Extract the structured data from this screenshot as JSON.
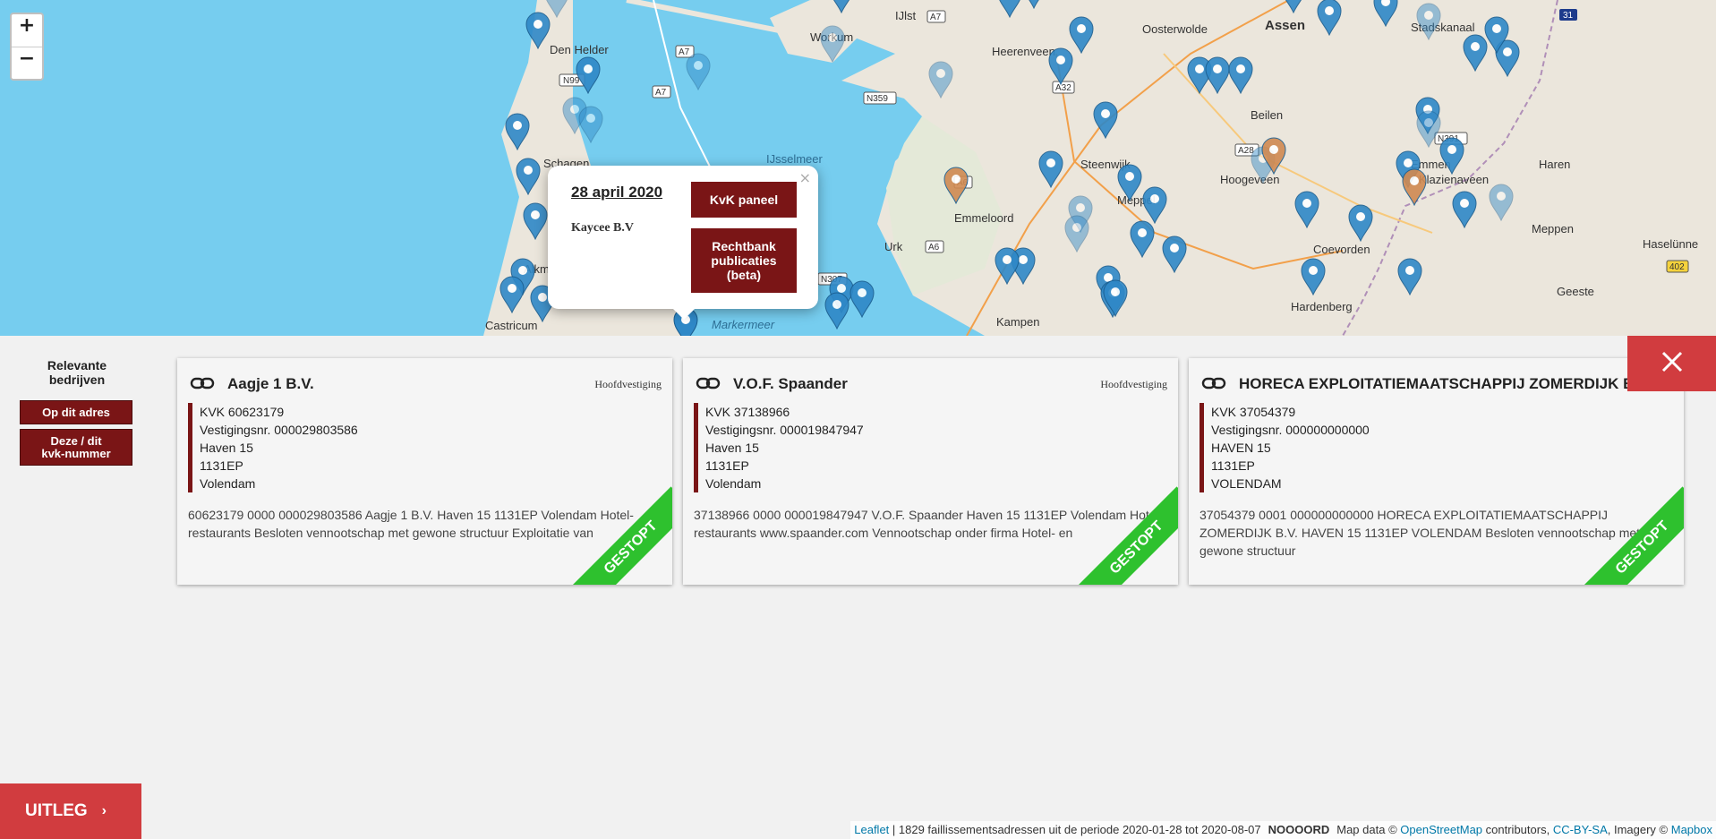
{
  "map": {
    "zoom_in": "+",
    "zoom_out": "−",
    "place_labels": [
      "Den Helder",
      "Schagen",
      "Alkmaar",
      "Castricum",
      "Workum",
      "IJlst",
      "Heerenveen",
      "Oosterwolde",
      "Assen",
      "Stadskanaal",
      "Beilen",
      "Steenwijk",
      "Emmeloord",
      "Urk",
      "Hoogeveen",
      "Meppel",
      "Emmen",
      "Klazienaveen",
      "Haren",
      "Coevorden",
      "Meppen",
      "Haselünne",
      "Kampen",
      "Hardenberg",
      "Geeste",
      "IJsselmeer",
      "Markermeer"
    ],
    "road_labels": [
      "A7",
      "A7",
      "N99",
      "A7",
      "A32",
      "N359",
      "N391",
      "A28",
      "A6",
      "A6",
      "N307",
      "31",
      "402"
    ],
    "colors": {
      "water": "#76cdef",
      "land": "#ebe6dc",
      "pin_blue": "#2f88c7",
      "pin_orange": "#d08a52"
    }
  },
  "popup": {
    "close": "×",
    "date": "28 april 2020",
    "company": "Kaycee B.V",
    "btn_kvk": "KvK paneel",
    "btn_rechtbank_l1": "Rechtbank",
    "btn_rechtbank_l2": "publicaties",
    "btn_rechtbank_l3": "(beta)"
  },
  "sidebar": {
    "title_l1": "Relevante",
    "title_l2": "bedrijven",
    "btn_address": "Op dit adres",
    "btn_kvk_l1": "Deze / dit",
    "btn_kvk_l2": "kvk-nummer"
  },
  "cards": [
    {
      "name": "Aagje 1 B.V.",
      "type": "Hoofdvestiging",
      "kvk": "KVK 60623179",
      "vestiging": "Vestigingsnr. 000029803586",
      "street": "Haven 15",
      "postcode": "1131EP",
      "city": "Volendam",
      "description": "60623179 0000 000029803586 Aagje 1 B.V. Haven 15 1131EP Volendam Hotel-restaurants Besloten vennootschap met gewone structuur Exploitatie van",
      "ribbon": "GESTOPT"
    },
    {
      "name": "V.O.F. Spaander",
      "type": "Hoofdvestiging",
      "kvk": "KVK 37138966",
      "vestiging": "Vestigingsnr. 000019847947",
      "street": "Haven 15",
      "postcode": "1131EP",
      "city": "Volendam",
      "description": "37138966 0000 000019847947 V.O.F. Spaander Haven 15 1131EP Volendam Hotel-restaurants www.spaander.com Vennootschap onder firma Hotel- en",
      "ribbon": "GESTOPT"
    },
    {
      "name": "HORECA EXPLOITATIEMAATSCHAPPIJ ZOMERDIJK B.V.",
      "type": "",
      "kvk": "KVK 37054379",
      "vestiging": "Vestigingsnr. 000000000000",
      "street": "HAVEN 15",
      "postcode": "1131EP",
      "city": "VOLENDAM",
      "description": "37054379 0001 000000000000 HORECA EXPLOITATIEMAATSCHAPPIJ ZOMERDIJK B.V. HAVEN 15 1131EP VOLENDAM Besloten vennootschap met gewone structuur",
      "ribbon": "GESTOPT"
    }
  ],
  "footer": {
    "uitleg": "UITLEG",
    "uitleg_chevron": "›",
    "attr_leaflet": "Leaflet",
    "attr_count": " | 1829 faillissementsadressen uit de periode 2020-01-28 tot 2020-08-07",
    "attr_nooord": "NOOOORD",
    "attr_mapdata": "Map data © ",
    "attr_osm": "OpenStreetMap",
    "attr_contrib": " contributors, ",
    "attr_ccbysa": "CC-BY-SA",
    "attr_imagery": ", Imagery © ",
    "attr_mapbox": "Mapbox"
  }
}
